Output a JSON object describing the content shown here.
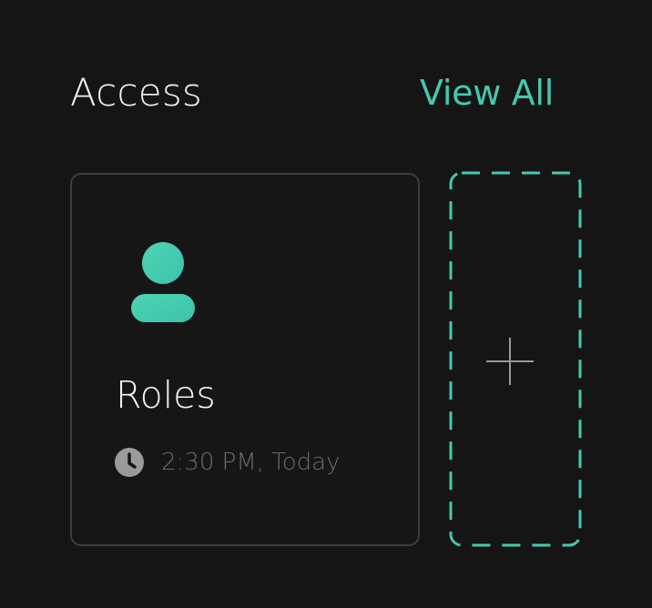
{
  "access": {
    "title": "Access",
    "view_all_label": "View All"
  },
  "roles_card": {
    "title": "Roles",
    "timestamp": "2:30 PM, Today",
    "icon": "user-icon",
    "meta_icon": "clock-icon"
  },
  "add_tile": {
    "icon": "plus-icon"
  },
  "colors": {
    "background": "#151515",
    "accent": "#45c9ae",
    "card_border": "#3d3d3d",
    "muted_text": "#6b6b6b"
  }
}
